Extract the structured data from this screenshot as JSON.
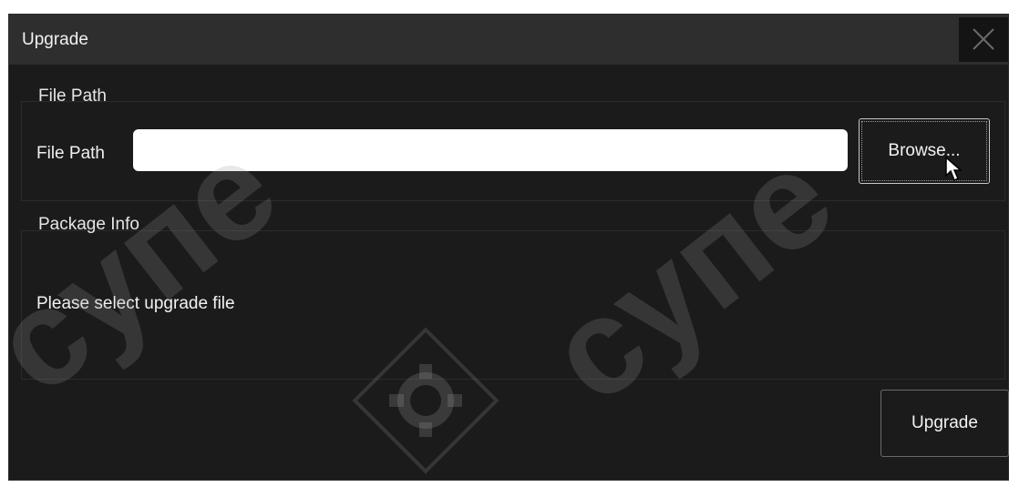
{
  "dialog": {
    "title": "Upgrade",
    "close_icon": "close-icon"
  },
  "file_path_group": {
    "label": "File Path",
    "field_label": "File Path",
    "input_value": "",
    "browse_label": "Browse..."
  },
  "package_info_group": {
    "label": "Package Info",
    "status_text": "Please select upgrade file"
  },
  "actions": {
    "upgrade_label": "Upgrade"
  },
  "watermark": {
    "text_1": "супе",
    "text_2": "супе",
    "logo_icon": "gear-logo-icon"
  },
  "colors": {
    "dialog_bg": "#1b1b1b",
    "titlebar_bg": "#2e2e2e",
    "text": "#f2f2f2",
    "input_bg": "#ffffff"
  }
}
